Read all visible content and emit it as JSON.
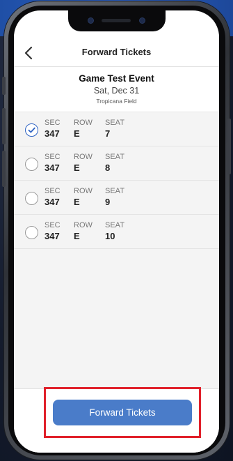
{
  "nav": {
    "title": "Forward Tickets",
    "back_icon": "chevron-left-icon"
  },
  "event": {
    "name": "Game Test Event",
    "date": "Sat, Dec 31",
    "venue": "Tropicana Field"
  },
  "columns": {
    "sec": "SEC",
    "row": "ROW",
    "seat": "SEAT"
  },
  "tickets": [
    {
      "sec": "347",
      "row": "E",
      "seat": "7",
      "selected": true
    },
    {
      "sec": "347",
      "row": "E",
      "seat": "8",
      "selected": false
    },
    {
      "sec": "347",
      "row": "E",
      "seat": "9",
      "selected": false
    },
    {
      "sec": "347",
      "row": "E",
      "seat": "10",
      "selected": false
    }
  ],
  "footer": {
    "forward_button_label": "Forward Tickets"
  },
  "colors": {
    "accent": "#4a7cc9",
    "checked": "#2f64c4",
    "highlight": "#e0202a"
  }
}
